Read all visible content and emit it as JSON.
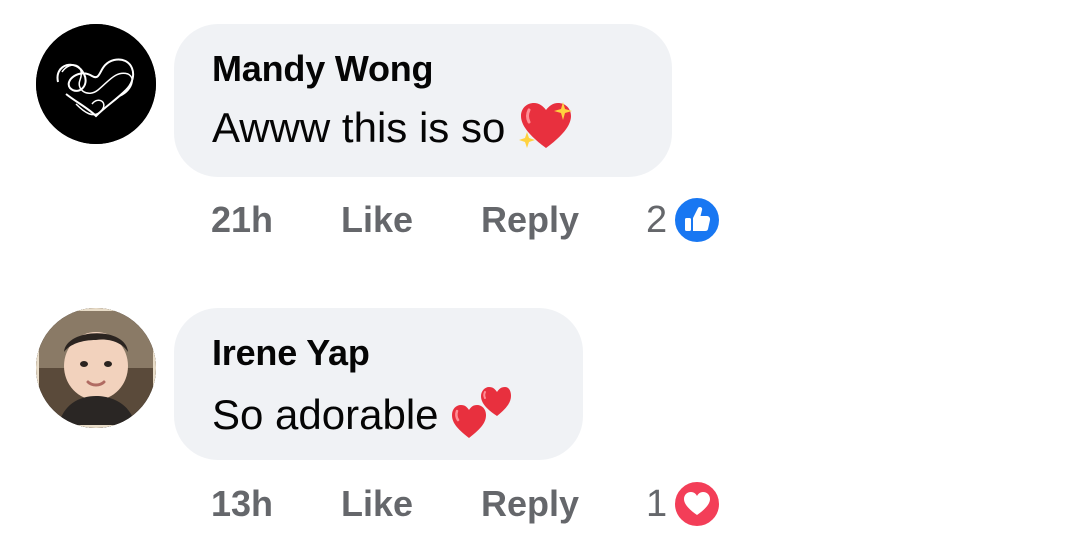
{
  "comments": [
    {
      "author": "Mandy Wong",
      "text": "Awww this is so",
      "emoji": "sparkling-heart",
      "time": "21h",
      "like_label": "Like",
      "reply_label": "Reply",
      "reaction_count": "2",
      "reaction_icon": "thumbs-up-icon",
      "avatar": "scribble-heart-avatar"
    },
    {
      "author": "Irene Yap",
      "text": "So adorable",
      "emoji": "two-hearts",
      "time": "13h",
      "like_label": "Like",
      "reply_label": "Reply",
      "reaction_count": "1",
      "reaction_icon": "love-heart-icon",
      "avatar": "photo-avatar"
    }
  ],
  "colors": {
    "bubble": "#f0f2f5",
    "secondary_text": "#65676b",
    "like_blue": "#1877f2",
    "love_red": "#f33e58"
  }
}
